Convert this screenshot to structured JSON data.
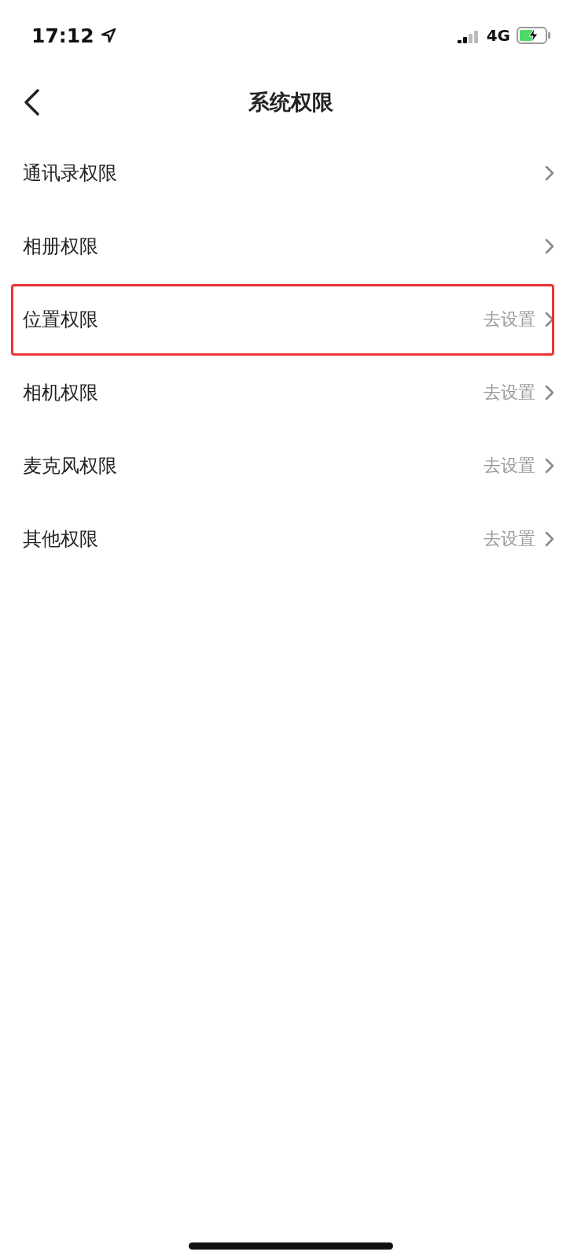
{
  "status_bar": {
    "time": "17:12",
    "network": "4G",
    "charging": true
  },
  "nav": {
    "title": "系统权限"
  },
  "rows": [
    {
      "label": "通讯录权限",
      "highlighted": false
    },
    {
      "label": "相册权限",
      "highlighted": false
    },
    {
      "label": "位置权限",
      "action": "去设置",
      "highlighted": true
    },
    {
      "label": "相机权限",
      "action": "去设置",
      "highlighted": false
    },
    {
      "label": "麦克风权限",
      "action": "去设置",
      "highlighted": false
    },
    {
      "label": "其他权限",
      "action": "去设置",
      "highlighted": false
    }
  ]
}
